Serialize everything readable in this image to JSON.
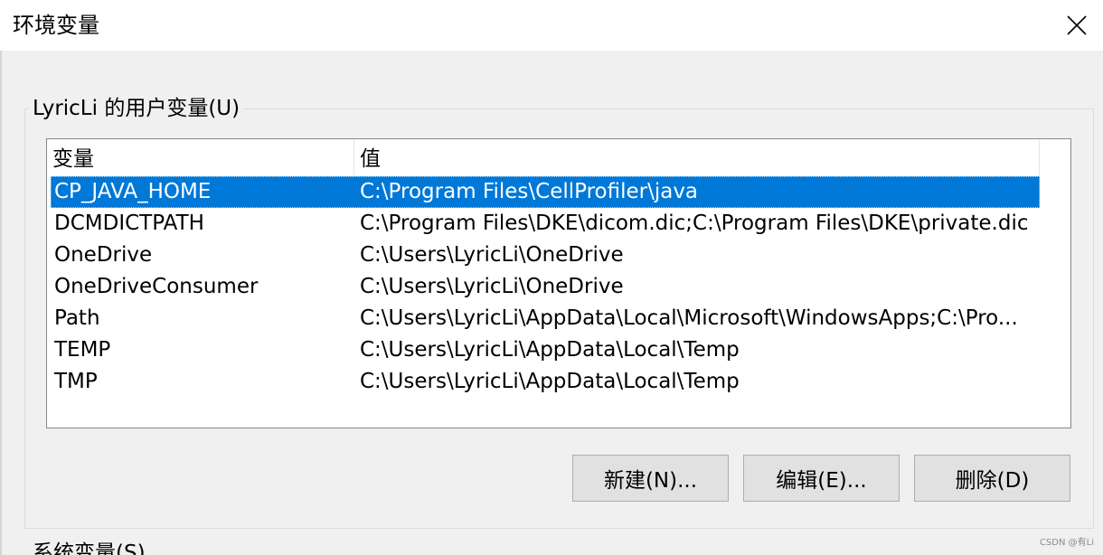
{
  "window": {
    "title": "环境变量",
    "close_icon": "close-icon"
  },
  "user_vars": {
    "group_title": "LyricLi 的用户变量(U)",
    "columns": [
      "变量",
      "值"
    ],
    "rows": [
      {
        "name": "CP_JAVA_HOME",
        "value": "C:\\Program Files\\CellProfiler\\java",
        "selected": true
      },
      {
        "name": "DCMDICTPATH",
        "value": "C:\\Program Files\\DKE\\dicom.dic;C:\\Program Files\\DKE\\private.dic",
        "selected": false
      },
      {
        "name": "OneDrive",
        "value": "C:\\Users\\LyricLi\\OneDrive",
        "selected": false
      },
      {
        "name": "OneDriveConsumer",
        "value": "C:\\Users\\LyricLi\\OneDrive",
        "selected": false
      },
      {
        "name": "Path",
        "value": "C:\\Users\\LyricLi\\AppData\\Local\\Microsoft\\WindowsApps;C:\\Pro...",
        "selected": false
      },
      {
        "name": "TEMP",
        "value": "C:\\Users\\LyricLi\\AppData\\Local\\Temp",
        "selected": false
      },
      {
        "name": "TMP",
        "value": "C:\\Users\\LyricLi\\AppData\\Local\\Temp",
        "selected": false
      }
    ],
    "buttons": {
      "new_label": "新建(N)...",
      "edit_label": "编辑(E)...",
      "delete_label": "删除(D)"
    }
  },
  "system_vars": {
    "group_title": "系统变量(S)"
  },
  "watermark": "CSDN @有Li",
  "colors": {
    "selection": "#0078d7",
    "background": "#f0f0f0",
    "titlebar": "#ffffff"
  }
}
